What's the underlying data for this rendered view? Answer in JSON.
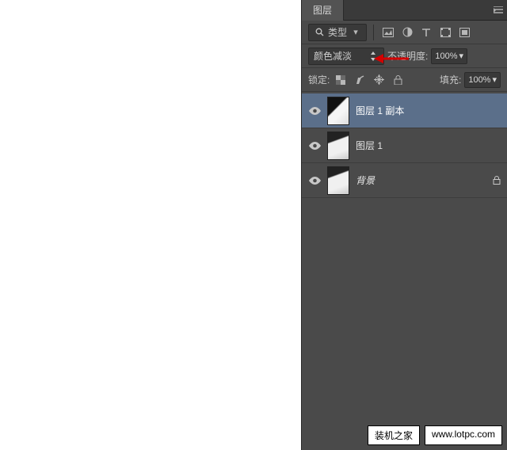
{
  "panel": {
    "title": "图层"
  },
  "filter": {
    "label": "类型",
    "icons": [
      "image",
      "adjust",
      "text",
      "shape",
      "smart"
    ]
  },
  "blend": {
    "mode": "颜色减淡",
    "opacity_label": "不透明度:",
    "opacity_value": "100%"
  },
  "lock": {
    "label": "锁定:",
    "fill_label": "填充:",
    "fill_value": "100%"
  },
  "layers": [
    {
      "name": "图层 1 副本",
      "visible": true,
      "selected": true,
      "locked": false
    },
    {
      "name": "图层 1",
      "visible": true,
      "selected": false,
      "locked": false
    },
    {
      "name": "背景",
      "visible": true,
      "selected": false,
      "locked": true
    }
  ],
  "watermark": {
    "site": "装机之家",
    "url": "www.lotpc.com"
  }
}
